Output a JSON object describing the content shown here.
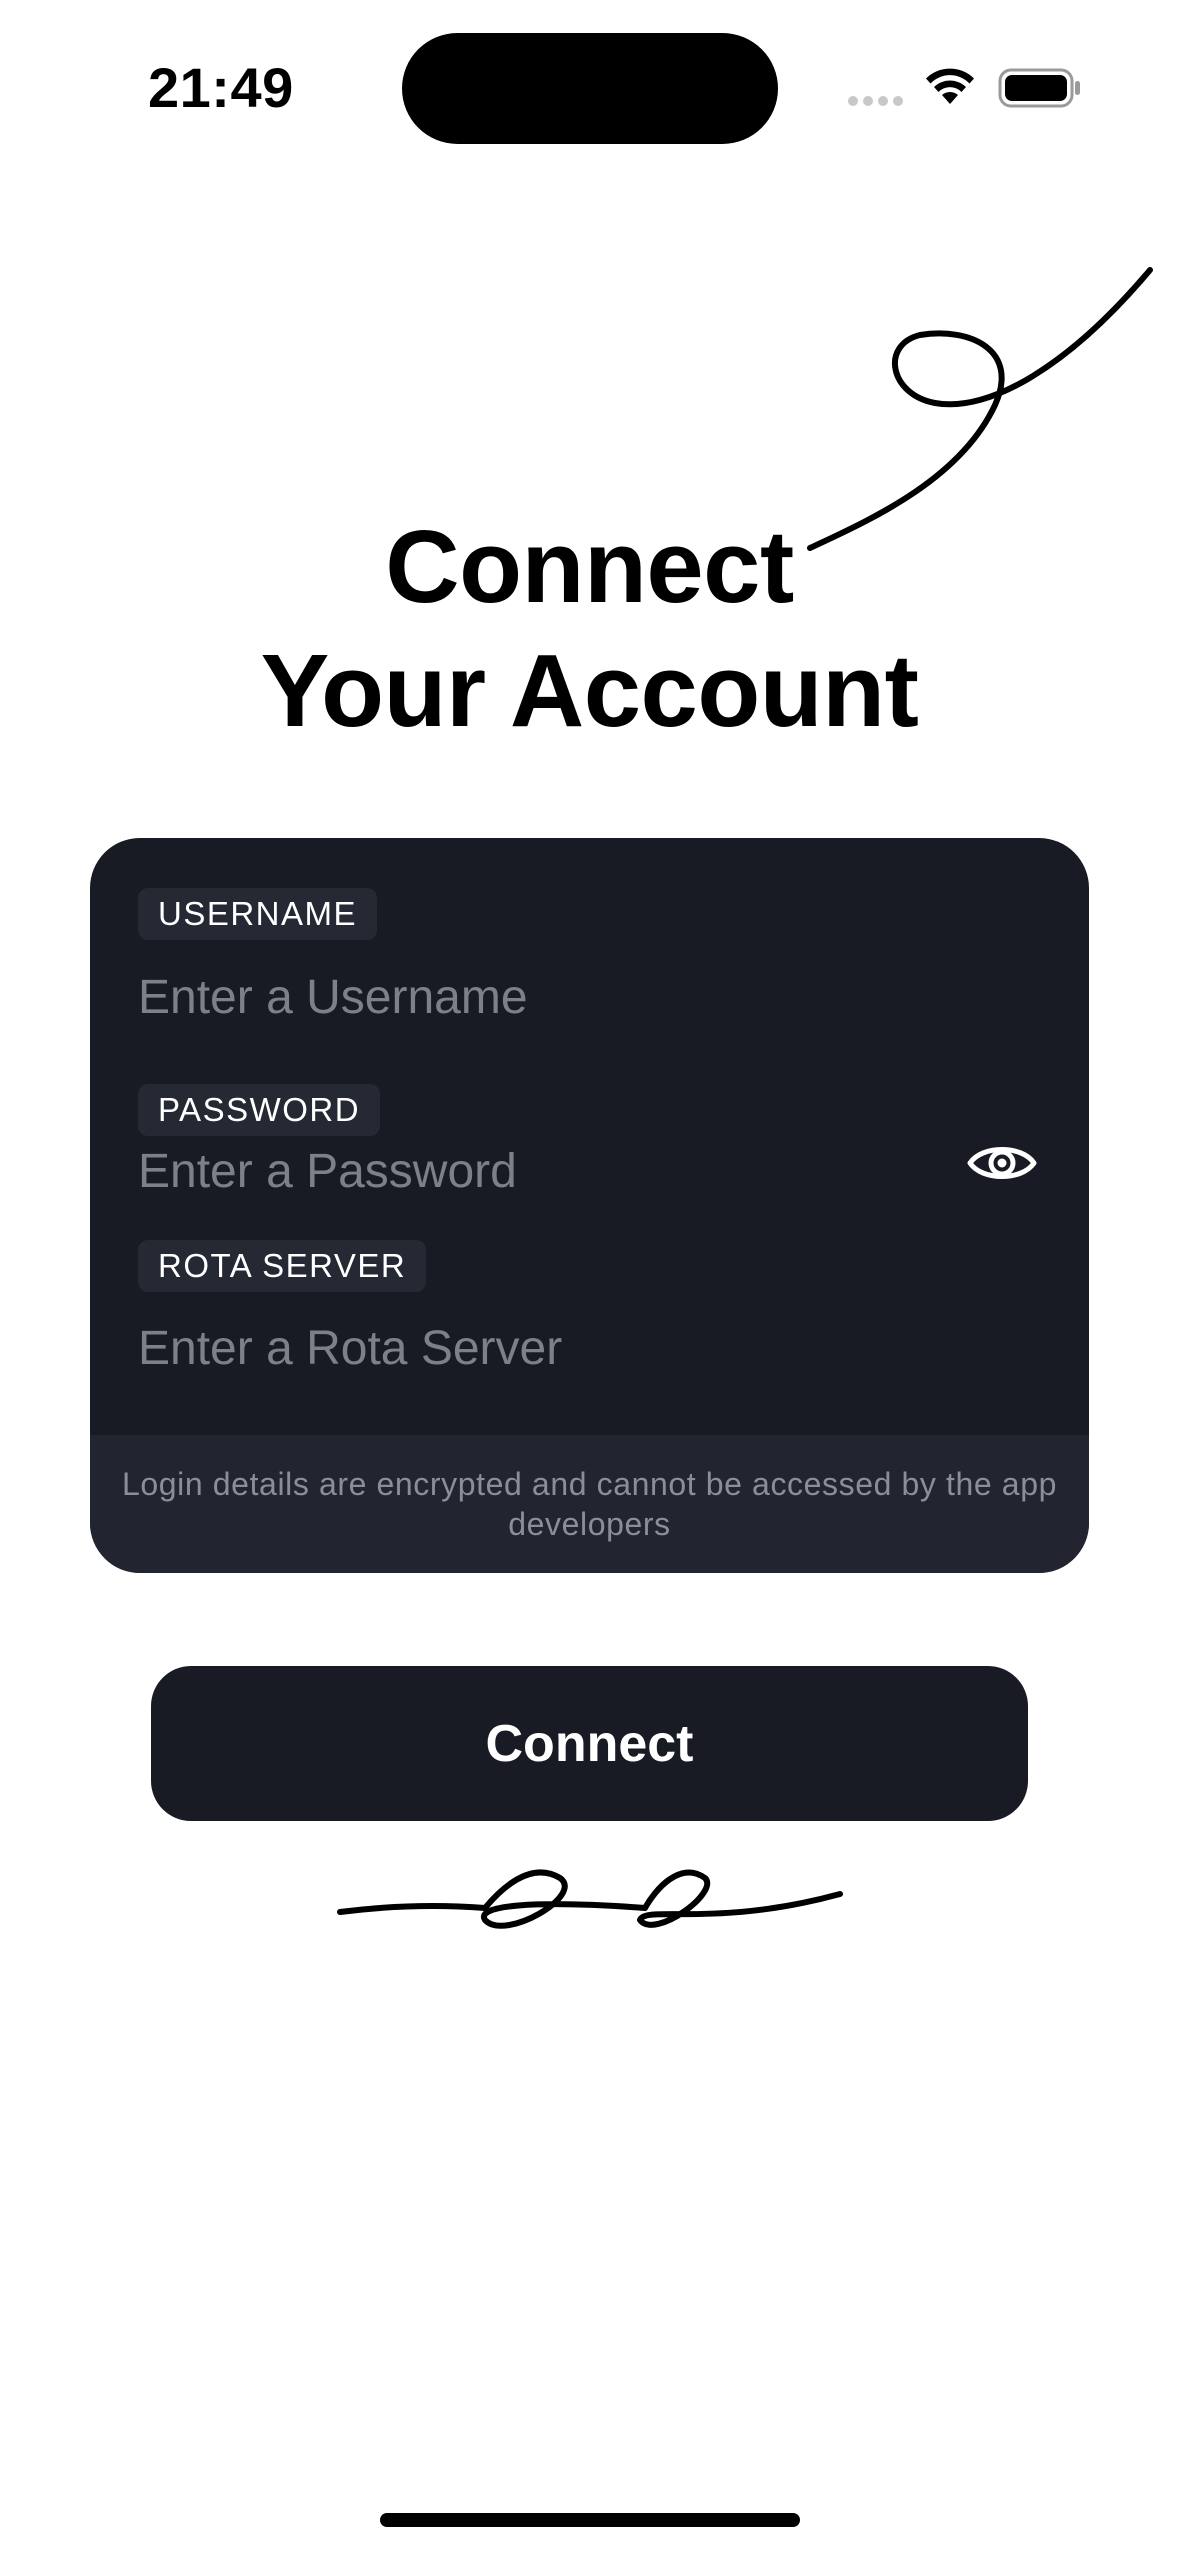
{
  "status_bar": {
    "time": "21:49",
    "icons": [
      "cellular-dots-icon",
      "wifi-icon",
      "battery-icon"
    ]
  },
  "title": {
    "line1": "Connect",
    "line2": "Your Account"
  },
  "form": {
    "username": {
      "label": "USERNAME",
      "placeholder": "Enter a Username",
      "value": ""
    },
    "password": {
      "label": "PASSWORD",
      "placeholder": "Enter a Password",
      "value": "",
      "toggle_icon": "eye-icon"
    },
    "server": {
      "label": "ROTA SERVER",
      "placeholder": "Enter a Rota Server",
      "value": ""
    },
    "footer_note": "Login details are encrypted and cannot be accessed by the app developers"
  },
  "connect_button": {
    "label": "Connect"
  },
  "colors": {
    "card_background": "#181b24",
    "card_footer_background": "#222530",
    "label_chip_background": "#252933",
    "placeholder_text": "#7c808b",
    "footer_text": "#8a8e99",
    "button_background": "#181b24"
  }
}
